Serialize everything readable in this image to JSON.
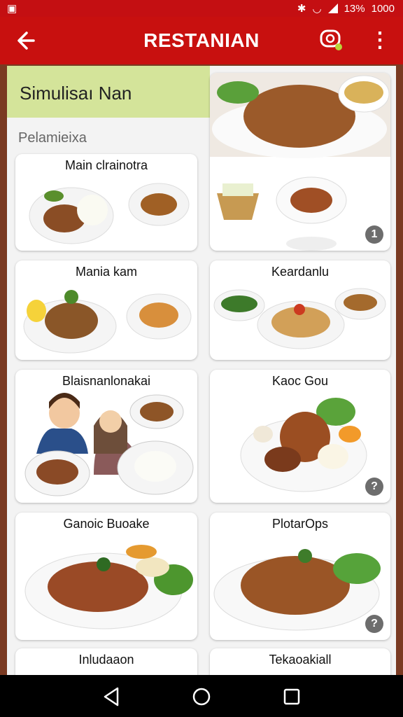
{
  "status_bar": {
    "battery": "13%",
    "time": "1000"
  },
  "app_bar": {
    "title": "RESTANIAN"
  },
  "banner": {
    "title": "Simulisaı Nan"
  },
  "section": {
    "subtitle": "Pelamieixa"
  },
  "cards": [
    {
      "name": "Main clrainotra",
      "badge": ""
    },
    {
      "name": "",
      "badge": "1"
    },
    {
      "name": "Mania kam",
      "badge": ""
    },
    {
      "name": "Keardanlu",
      "badge": ""
    },
    {
      "name": "Blaisnanlonakai",
      "badge": ""
    },
    {
      "name": "Kaoc Gou",
      "badge": "?"
    },
    {
      "name": "Ganoic Buoake",
      "badge": ""
    },
    {
      "name": "PlotarOps",
      "badge": "?"
    },
    {
      "name": "Inludaaon",
      "badge": ""
    },
    {
      "name": "Tekaoakiall",
      "badge": ""
    }
  ]
}
